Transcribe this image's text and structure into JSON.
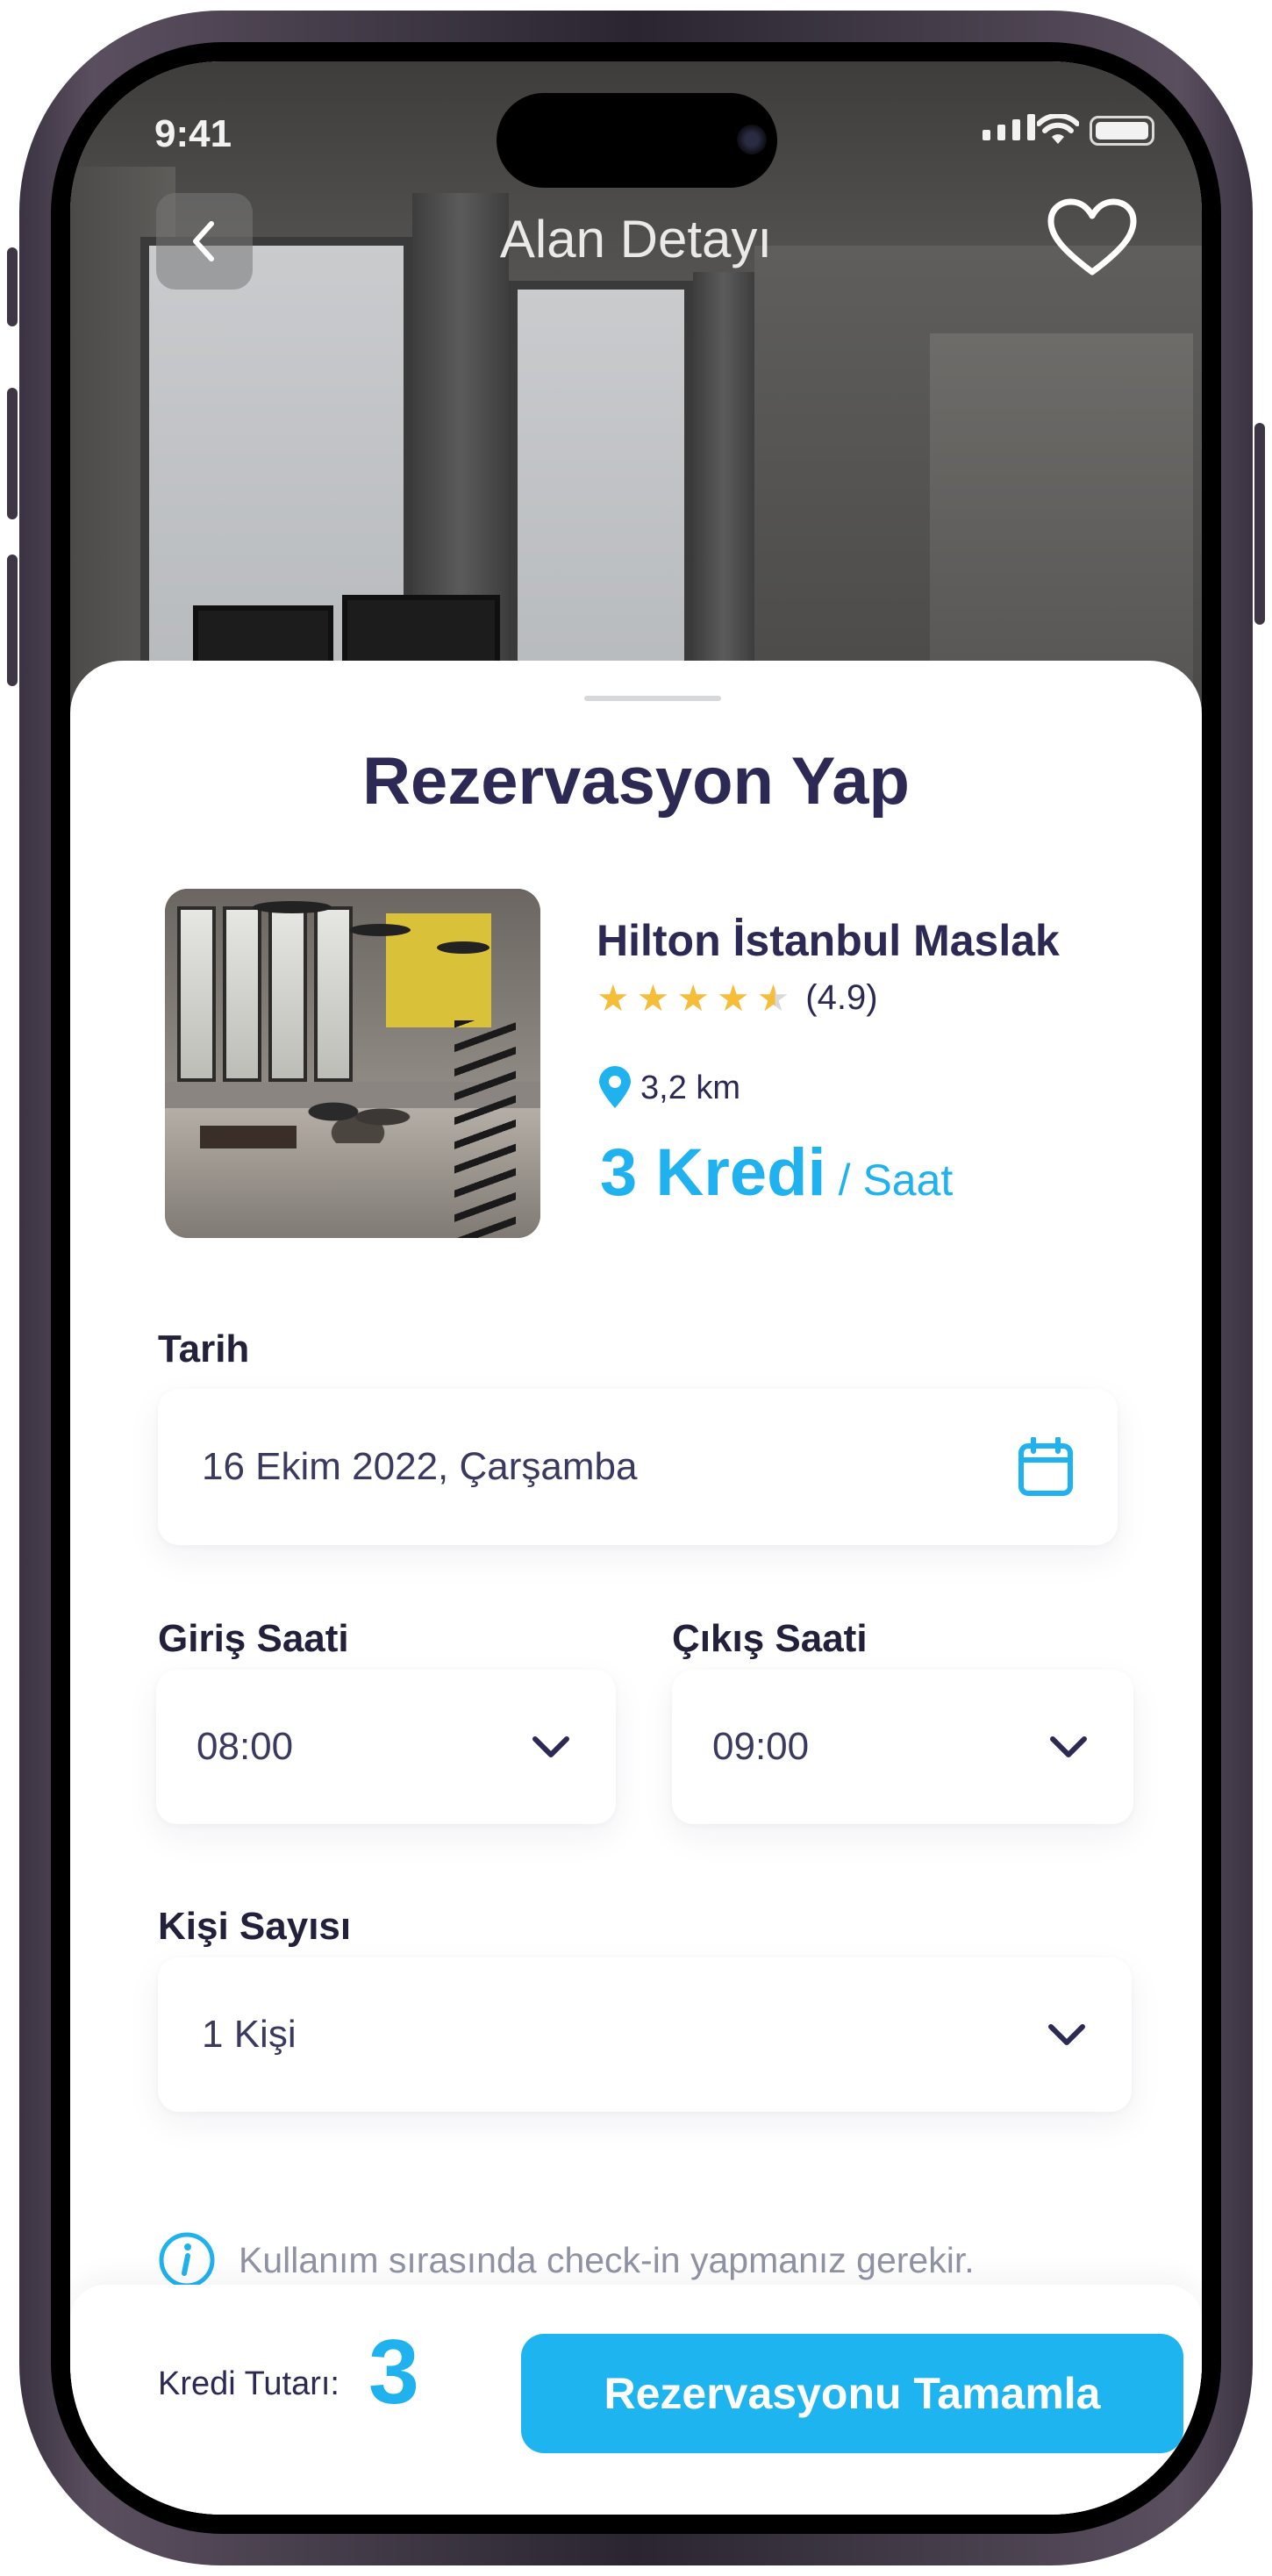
{
  "status_bar": {
    "time": "9:41"
  },
  "nav": {
    "title": "Alan Detayı"
  },
  "sheet": {
    "title": "Rezervasyon Yap",
    "venue": {
      "name": "Hilton İstanbul Maslak",
      "rating_stars": 4.5,
      "rating_text": "(4.9)",
      "distance": "3,2 km",
      "price_value": "3 Kredi",
      "price_unit": "/ Saat"
    },
    "date": {
      "label": "Tarih",
      "value": "16 Ekim 2022, Çarşamba"
    },
    "checkin": {
      "label": "Giriş Saati",
      "value": "08:00"
    },
    "checkout": {
      "label": "Çıkış Saati",
      "value": "09:00"
    },
    "guests": {
      "label": "Kişi Sayısı",
      "value": "1 Kişi"
    },
    "info": {
      "text": "Kullanım sırasında check-in yapmanız gerekir."
    }
  },
  "footer": {
    "credit_label": "Kredi Tutarı:",
    "credit_value": "3",
    "cta_label": "Rezervasyonu Tamamla"
  },
  "colors": {
    "accent": "#1EB4F0",
    "text_dark": "#2C2A55",
    "star": "#F5BD3A",
    "muted": "#8F93A3"
  }
}
